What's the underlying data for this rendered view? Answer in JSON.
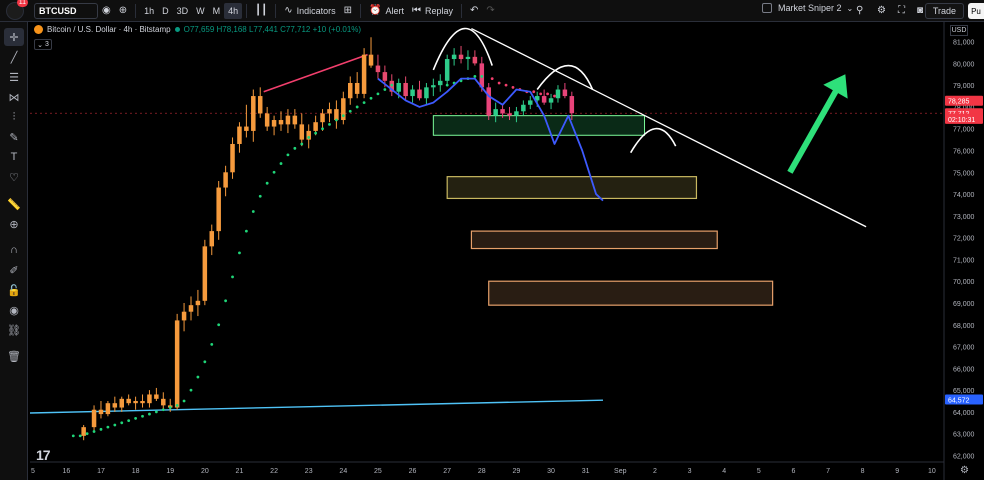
{
  "toolbar": {
    "notification_count": "11",
    "symbol": "BTCUSD",
    "timeframes": [
      "1h",
      "D",
      "3D",
      "W",
      "M",
      "4h"
    ],
    "active_timeframe": "4h",
    "indicators_label": "Indicators",
    "alert_label": "Alert",
    "replay_label": "Replay",
    "layout_name": "Market Sniper 2",
    "trade_label": "Trade",
    "publish_label": "Pu"
  },
  "legend": {
    "title": "Bitcoin / U.S. Dollar · 4h · Bitstamp",
    "ohlc": "O77,659 H78,168 L77,441 C77,712 +10 (+0.01%)",
    "indicator_count": "3"
  },
  "currency": "USD",
  "chart_data": {
    "type": "candlestick",
    "title": "Bitcoin / U.S. Dollar · 4h · Bitstamp",
    "y_ticks": [
      62000,
      63000,
      64000,
      65000,
      66000,
      67000,
      68000,
      69000,
      70000,
      71000,
      72000,
      73000,
      74000,
      75000,
      76000,
      77000,
      78000,
      79000,
      80000,
      81000
    ],
    "ylim": [
      61700,
      81900
    ],
    "x_ticks": [
      "5",
      "16",
      "17",
      "18",
      "19",
      "20",
      "21",
      "22",
      "23",
      "24",
      "25",
      "26",
      "27",
      "28",
      "29",
      "30",
      "31",
      "Sep",
      "2",
      "3",
      "4",
      "5",
      "6",
      "7",
      "8",
      "9",
      "10"
    ],
    "x_tick_days": [
      -13,
      16,
      17,
      18,
      19,
      20,
      21,
      22,
      23,
      24,
      25,
      26,
      27,
      28,
      29,
      30,
      31,
      32,
      33,
      34,
      35,
      36,
      37,
      38,
      39,
      40,
      41
    ],
    "xlim": [
      14.95,
      41.35
    ],
    "price_labels": [
      {
        "text": "78,285",
        "value": 78285,
        "color": "#f23645"
      },
      {
        "text": "77,712",
        "value": 77712,
        "color": "#f23645"
      },
      {
        "text": "02:10:31",
        "value": 77450,
        "color": "#f23645"
      },
      {
        "text": "64,572",
        "value": 64572,
        "color": "#2962ff"
      }
    ],
    "current_price": 77712,
    "candles": [
      {
        "day": 16.5,
        "o": 62900,
        "h": 63400,
        "l": 62700,
        "c": 63300
      },
      {
        "day": 16.8,
        "o": 63300,
        "h": 64300,
        "l": 63100,
        "c": 64100
      },
      {
        "day": 17.0,
        "o": 64100,
        "h": 64500,
        "l": 63700,
        "c": 63900
      },
      {
        "day": 17.2,
        "o": 63900,
        "h": 64500,
        "l": 63800,
        "c": 64400
      },
      {
        "day": 17.4,
        "o": 64400,
        "h": 64700,
        "l": 64000,
        "c": 64200
      },
      {
        "day": 17.6,
        "o": 64200,
        "h": 64700,
        "l": 64000,
        "c": 64600
      },
      {
        "day": 17.8,
        "o": 64600,
        "h": 64800,
        "l": 64300,
        "c": 64400
      },
      {
        "day": 18.0,
        "o": 64400,
        "h": 64700,
        "l": 64100,
        "c": 64500
      },
      {
        "day": 18.2,
        "o": 64500,
        "h": 64800,
        "l": 64200,
        "c": 64400
      },
      {
        "day": 18.4,
        "o": 64400,
        "h": 65000,
        "l": 64200,
        "c": 64800
      },
      {
        "day": 18.6,
        "o": 64800,
        "h": 65100,
        "l": 64500,
        "c": 64600
      },
      {
        "day": 18.8,
        "o": 64600,
        "h": 64900,
        "l": 64100,
        "c": 64300
      },
      {
        "day": 19.0,
        "o": 64300,
        "h": 64600,
        "l": 64000,
        "c": 64200
      },
      {
        "day": 19.2,
        "o": 64200,
        "h": 68500,
        "l": 64100,
        "c": 68200
      },
      {
        "day": 19.4,
        "o": 68200,
        "h": 69000,
        "l": 67700,
        "c": 68600
      },
      {
        "day": 19.6,
        "o": 68600,
        "h": 69300,
        "l": 68200,
        "c": 68900
      },
      {
        "day": 19.8,
        "o": 68900,
        "h": 69600,
        "l": 68400,
        "c": 69100
      },
      {
        "day": 20.0,
        "o": 69100,
        "h": 71900,
        "l": 68900,
        "c": 71600
      },
      {
        "day": 20.2,
        "o": 71600,
        "h": 72600,
        "l": 71200,
        "c": 72300
      },
      {
        "day": 20.4,
        "o": 72300,
        "h": 74600,
        "l": 71900,
        "c": 74300
      },
      {
        "day": 20.6,
        "o": 74300,
        "h": 75300,
        "l": 73900,
        "c": 75000
      },
      {
        "day": 20.8,
        "o": 75000,
        "h": 76600,
        "l": 74700,
        "c": 76300
      },
      {
        "day": 21.0,
        "o": 76300,
        "h": 77300,
        "l": 75900,
        "c": 77100
      },
      {
        "day": 21.2,
        "o": 77100,
        "h": 78100,
        "l": 76600,
        "c": 76900
      },
      {
        "day": 21.4,
        "o": 76900,
        "h": 78800,
        "l": 76400,
        "c": 78500
      },
      {
        "day": 21.6,
        "o": 78500,
        "h": 78900,
        "l": 77500,
        "c": 77700
      },
      {
        "day": 21.8,
        "o": 77700,
        "h": 78000,
        "l": 76900,
        "c": 77100
      },
      {
        "day": 22.0,
        "o": 77100,
        "h": 77600,
        "l": 76700,
        "c": 77400
      },
      {
        "day": 22.2,
        "o": 77400,
        "h": 77800,
        "l": 76900,
        "c": 77200
      },
      {
        "day": 22.4,
        "o": 77200,
        "h": 77900,
        "l": 76800,
        "c": 77600
      },
      {
        "day": 22.6,
        "o": 77600,
        "h": 77900,
        "l": 77000,
        "c": 77200
      },
      {
        "day": 22.8,
        "o": 77200,
        "h": 77700,
        "l": 76200,
        "c": 76500
      },
      {
        "day": 23.0,
        "o": 76500,
        "h": 77200,
        "l": 76100,
        "c": 76900
      },
      {
        "day": 23.2,
        "o": 76900,
        "h": 77600,
        "l": 76700,
        "c": 77300
      },
      {
        "day": 23.4,
        "o": 77300,
        "h": 77900,
        "l": 76900,
        "c": 77700
      },
      {
        "day": 23.6,
        "o": 77700,
        "h": 78200,
        "l": 77300,
        "c": 77900
      },
      {
        "day": 23.8,
        "o": 77900,
        "h": 78300,
        "l": 77000,
        "c": 77400
      },
      {
        "day": 24.0,
        "o": 77400,
        "h": 78700,
        "l": 77200,
        "c": 78400
      },
      {
        "day": 24.2,
        "o": 78400,
        "h": 79400,
        "l": 78100,
        "c": 79100
      },
      {
        "day": 24.4,
        "o": 79100,
        "h": 79600,
        "l": 78400,
        "c": 78600
      },
      {
        "day": 24.6,
        "o": 78600,
        "h": 80700,
        "l": 78400,
        "c": 80400
      },
      {
        "day": 24.8,
        "o": 80400,
        "h": 81200,
        "l": 79800,
        "c": 79900
      },
      {
        "day": 25.0,
        "o": 79900,
        "h": 80400,
        "l": 79300,
        "c": 79600
      },
      {
        "day": 25.2,
        "o": 79600,
        "h": 79900,
        "l": 78900,
        "c": 79200
      },
      {
        "day": 25.4,
        "o": 79200,
        "h": 79500,
        "l": 78500,
        "c": 78700
      },
      {
        "day": 25.6,
        "o": 78700,
        "h": 79300,
        "l": 78400,
        "c": 79100
      },
      {
        "day": 25.8,
        "o": 79100,
        "h": 79400,
        "l": 78300,
        "c": 78500
      },
      {
        "day": 26.0,
        "o": 78500,
        "h": 79000,
        "l": 78200,
        "c": 78800
      },
      {
        "day": 26.2,
        "o": 78800,
        "h": 79200,
        "l": 78300,
        "c": 78400
      },
      {
        "day": 26.4,
        "o": 78400,
        "h": 79100,
        "l": 78100,
        "c": 78900
      },
      {
        "day": 26.6,
        "o": 78900,
        "h": 79300,
        "l": 78500,
        "c": 79000
      },
      {
        "day": 26.8,
        "o": 79000,
        "h": 79500,
        "l": 78700,
        "c": 79200
      },
      {
        "day": 27.0,
        "o": 79200,
        "h": 80400,
        "l": 79000,
        "c": 80200
      },
      {
        "day": 27.2,
        "o": 80200,
        "h": 80700,
        "l": 79900,
        "c": 80400
      },
      {
        "day": 27.4,
        "o": 80400,
        "h": 80800,
        "l": 80000,
        "c": 80200
      },
      {
        "day": 27.6,
        "o": 80200,
        "h": 80600,
        "l": 79700,
        "c": 80300
      },
      {
        "day": 27.8,
        "o": 80300,
        "h": 80600,
        "l": 79900,
        "c": 80000
      },
      {
        "day": 28.0,
        "o": 80000,
        "h": 80300,
        "l": 78700,
        "c": 78900
      },
      {
        "day": 28.2,
        "o": 78900,
        "h": 79100,
        "l": 77400,
        "c": 77600
      },
      {
        "day": 28.4,
        "o": 77600,
        "h": 78200,
        "l": 77300,
        "c": 77900
      },
      {
        "day": 28.6,
        "o": 77900,
        "h": 78100,
        "l": 77500,
        "c": 77700
      },
      {
        "day": 28.8,
        "o": 77700,
        "h": 78000,
        "l": 77400,
        "c": 77600
      },
      {
        "day": 29.0,
        "o": 77600,
        "h": 78000,
        "l": 77300,
        "c": 77800
      },
      {
        "day": 29.2,
        "o": 77800,
        "h": 78300,
        "l": 77600,
        "c": 78100
      },
      {
        "day": 29.4,
        "o": 78100,
        "h": 78500,
        "l": 77900,
        "c": 78300
      },
      {
        "day": 29.6,
        "o": 78300,
        "h": 78700,
        "l": 78000,
        "c": 78500
      },
      {
        "day": 29.8,
        "o": 78500,
        "h": 78800,
        "l": 78100,
        "c": 78200
      },
      {
        "day": 30.0,
        "o": 78200,
        "h": 78600,
        "l": 77900,
        "c": 78400
      },
      {
        "day": 30.2,
        "o": 78400,
        "h": 79000,
        "l": 78200,
        "c": 78800
      },
      {
        "day": 30.4,
        "o": 78800,
        "h": 79100,
        "l": 78400,
        "c": 78500
      },
      {
        "day": 30.6,
        "o": 78500,
        "h": 78700,
        "l": 77400,
        "c": 77712
      }
    ],
    "psar": [
      {
        "day": 16.2,
        "v": 62900
      },
      {
        "day": 16.4,
        "v": 62900
      },
      {
        "day": 16.6,
        "v": 63000
      },
      {
        "day": 16.8,
        "v": 63100
      },
      {
        "day": 17.0,
        "v": 63200
      },
      {
        "day": 17.2,
        "v": 63300
      },
      {
        "day": 17.4,
        "v": 63400
      },
      {
        "day": 17.6,
        "v": 63500
      },
      {
        "day": 17.8,
        "v": 63600
      },
      {
        "day": 18.0,
        "v": 63700
      },
      {
        "day": 18.2,
        "v": 63800
      },
      {
        "day": 18.4,
        "v": 63900
      },
      {
        "day": 18.6,
        "v": 64000
      },
      {
        "day": 18.8,
        "v": 64100
      },
      {
        "day": 19.0,
        "v": 64200
      },
      {
        "day": 19.2,
        "v": 64300
      },
      {
        "day": 19.4,
        "v": 64500
      },
      {
        "day": 19.6,
        "v": 65000
      },
      {
        "day": 19.8,
        "v": 65600
      },
      {
        "day": 20.0,
        "v": 66300
      },
      {
        "day": 20.2,
        "v": 67100
      },
      {
        "day": 20.4,
        "v": 68000
      },
      {
        "day": 20.6,
        "v": 69100
      },
      {
        "day": 20.8,
        "v": 70200
      },
      {
        "day": 21.0,
        "v": 71300
      },
      {
        "day": 21.2,
        "v": 72300
      },
      {
        "day": 21.4,
        "v": 73200
      },
      {
        "day": 21.6,
        "v": 73900
      },
      {
        "day": 21.8,
        "v": 74500
      },
      {
        "day": 22.0,
        "v": 75000
      },
      {
        "day": 22.2,
        "v": 75400
      },
      {
        "day": 22.4,
        "v": 75800
      },
      {
        "day": 22.6,
        "v": 76100
      },
      {
        "day": 22.8,
        "v": 76300
      },
      {
        "day": 23.0,
        "v": 76600
      },
      {
        "day": 23.2,
        "v": 76800
      },
      {
        "day": 23.4,
        "v": 77000
      },
      {
        "day": 23.6,
        "v": 77200
      },
      {
        "day": 23.8,
        "v": 77400
      },
      {
        "day": 24.0,
        "v": 77600
      },
      {
        "day": 24.2,
        "v": 77800
      },
      {
        "day": 24.4,
        "v": 78000
      },
      {
        "day": 24.6,
        "v": 78200
      },
      {
        "day": 24.8,
        "v": 78400
      },
      {
        "day": 25.0,
        "v": 78600
      },
      {
        "day": 25.2,
        "v": 78800
      },
      {
        "day": 25.4,
        "v": 79000
      },
      {
        "day": 27.0,
        "v": 79000
      },
      {
        "day": 27.2,
        "v": 79100
      },
      {
        "day": 27.4,
        "v": 79200
      },
      {
        "day": 27.6,
        "v": 79300
      },
      {
        "day": 27.8,
        "v": 79400
      },
      {
        "day": 28.0,
        "v": 79400
      },
      {
        "day": 28.3,
        "v": 79300
      },
      {
        "day": 28.5,
        "v": 79100
      },
      {
        "day": 28.7,
        "v": 79000
      },
      {
        "day": 28.9,
        "v": 78900
      },
      {
        "day": 29.1,
        "v": 78800
      },
      {
        "day": 29.3,
        "v": 78700
      },
      {
        "day": 29.5,
        "v": 78700
      },
      {
        "day": 29.7,
        "v": 78600
      },
      {
        "day": 29.9,
        "v": 78600
      },
      {
        "day": 30.1,
        "v": 78500
      }
    ],
    "psar_red_from_day": 28.3,
    "drawings": {
      "support_line": {
        "from": {
          "day": 14.95,
          "v": 63950
        },
        "to": {
          "day": 31.5,
          "v": 64540
        },
        "color": "#4fc3f7"
      },
      "pink_trendline": {
        "from": {
          "day": 21.7,
          "v": 78700
        },
        "to": {
          "day": 24.7,
          "v": 80400
        },
        "color": "#f23f6d"
      },
      "downtrend_line": {
        "from": {
          "day": 27.7,
          "v": 81600
        },
        "to": {
          "day": 39.1,
          "v": 72500
        },
        "color": "#ffffff"
      },
      "green_zone": {
        "from_day": 26.6,
        "to_day": 32.7,
        "top": 77600,
        "bottom": 76700,
        "color": "#26a65b"
      },
      "zones": [
        {
          "from_day": 27.0,
          "to_day": 34.2,
          "top": 74800,
          "bottom": 73800,
          "color": "#c8b860"
        },
        {
          "from_day": 27.7,
          "to_day": 34.8,
          "top": 72300,
          "bottom": 71500,
          "color": "#e6a06a"
        },
        {
          "from_day": 28.2,
          "to_day": 36.4,
          "top": 70000,
          "bottom": 68900,
          "color": "#e6a06a"
        }
      ],
      "arrow": {
        "from": {
          "day": 36.9,
          "v": 75000
        },
        "to": {
          "day": 38.5,
          "v": 79500
        },
        "color": "#2ee07a"
      },
      "blue_path": [
        {
          "day": 25.0,
          "v": 79300
        },
        {
          "day": 25.4,
          "v": 78800
        },
        {
          "day": 25.8,
          "v": 78300
        },
        {
          "day": 26.2,
          "v": 78000
        },
        {
          "day": 26.6,
          "v": 78200
        },
        {
          "day": 27.0,
          "v": 78700
        },
        {
          "day": 27.4,
          "v": 79300
        },
        {
          "day": 27.8,
          "v": 79300
        },
        {
          "day": 28.2,
          "v": 78500
        },
        {
          "day": 28.6,
          "v": 78100
        },
        {
          "day": 29.0,
          "v": 78800
        },
        {
          "day": 29.4,
          "v": 78700
        },
        {
          "day": 29.8,
          "v": 77600
        },
        {
          "day": 30.1,
          "v": 76300
        },
        {
          "day": 30.5,
          "v": 77600
        },
        {
          "day": 30.9,
          "v": 76000
        },
        {
          "day": 31.3,
          "v": 74000
        },
        {
          "day": 31.5,
          "v": 73700
        }
      ],
      "white_arcs": [
        {
          "from": {
            "day": 26.6,
            "v": 79700
          },
          "peak": {
            "day": 27.5,
            "v": 81600
          },
          "to": {
            "day": 28.3,
            "v": 79900
          }
        },
        {
          "from": {
            "day": 29.6,
            "v": 78800
          },
          "peak": {
            "day": 30.5,
            "v": 79900
          },
          "to": {
            "day": 31.2,
            "v": 78800
          }
        },
        {
          "from": {
            "day": 32.3,
            "v": 75900
          },
          "peak": {
            "day": 33.0,
            "v": 77000
          },
          "to": {
            "day": 33.6,
            "v": 76200
          }
        }
      ]
    }
  }
}
